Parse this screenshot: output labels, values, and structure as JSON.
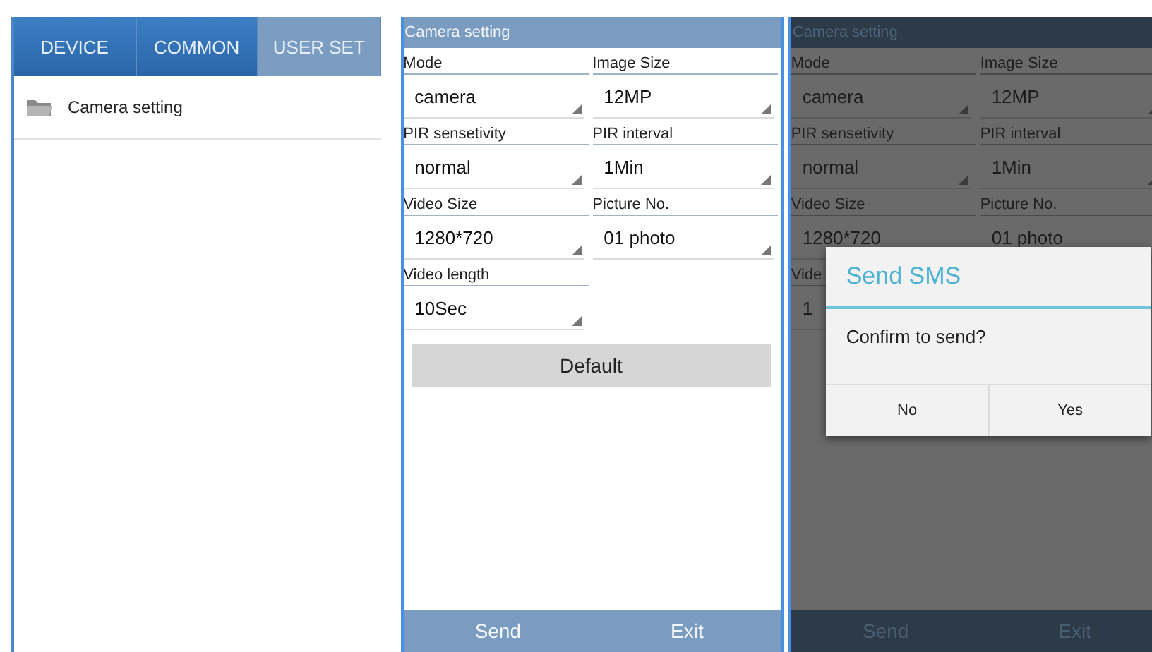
{
  "user_set_screen": {
    "tabs": [
      {
        "label": "DEVICE",
        "selected": false
      },
      {
        "label": "COMMON",
        "selected": false
      },
      {
        "label": "USER SET",
        "selected": true
      }
    ],
    "items": [
      {
        "label": "Camera setting"
      }
    ]
  },
  "camera_setting_screen": {
    "title": "Camera setting",
    "dimmed": false,
    "fields": [
      {
        "label": "Mode",
        "value": "camera",
        "covered": false
      },
      {
        "label": "Image Size",
        "value": "12MP",
        "covered": false
      },
      {
        "label": "PIR sensetivity",
        "value": "normal",
        "covered": false
      },
      {
        "label": "PIR interval",
        "value": "1Min",
        "covered": false
      },
      {
        "label": "Video Size",
        "value": "1280*720",
        "covered": false
      },
      {
        "label": "Picture No.",
        "value": "01 photo",
        "covered": false
      },
      {
        "label": "Video length",
        "value": "10Sec",
        "covered": false
      }
    ],
    "default_button": "Default",
    "bottom_buttons": [
      "Send",
      "Exit"
    ]
  },
  "confirm_screen": {
    "title": "Camera setting",
    "dimmed": true,
    "fields": [
      {
        "label": "Mode",
        "value": "camera",
        "covered": false
      },
      {
        "label": "Image Size",
        "value": "12MP",
        "covered": false
      },
      {
        "label": "PIR sensetivity",
        "value": "normal",
        "covered": false
      },
      {
        "label": "PIR interval",
        "value": "1Min",
        "covered": false
      },
      {
        "label": "Video Size",
        "value": "1280*720",
        "covered": true
      },
      {
        "label": "Picture No.",
        "value": "01 photo",
        "covered": true
      },
      {
        "label": "Vide",
        "value": "1",
        "covered": true
      }
    ],
    "bottom_buttons": [
      "Send",
      "Exit"
    ],
    "dialog": {
      "title": "Send SMS",
      "message": "Confirm to send?",
      "buttons": [
        "No",
        "Yes"
      ]
    }
  }
}
